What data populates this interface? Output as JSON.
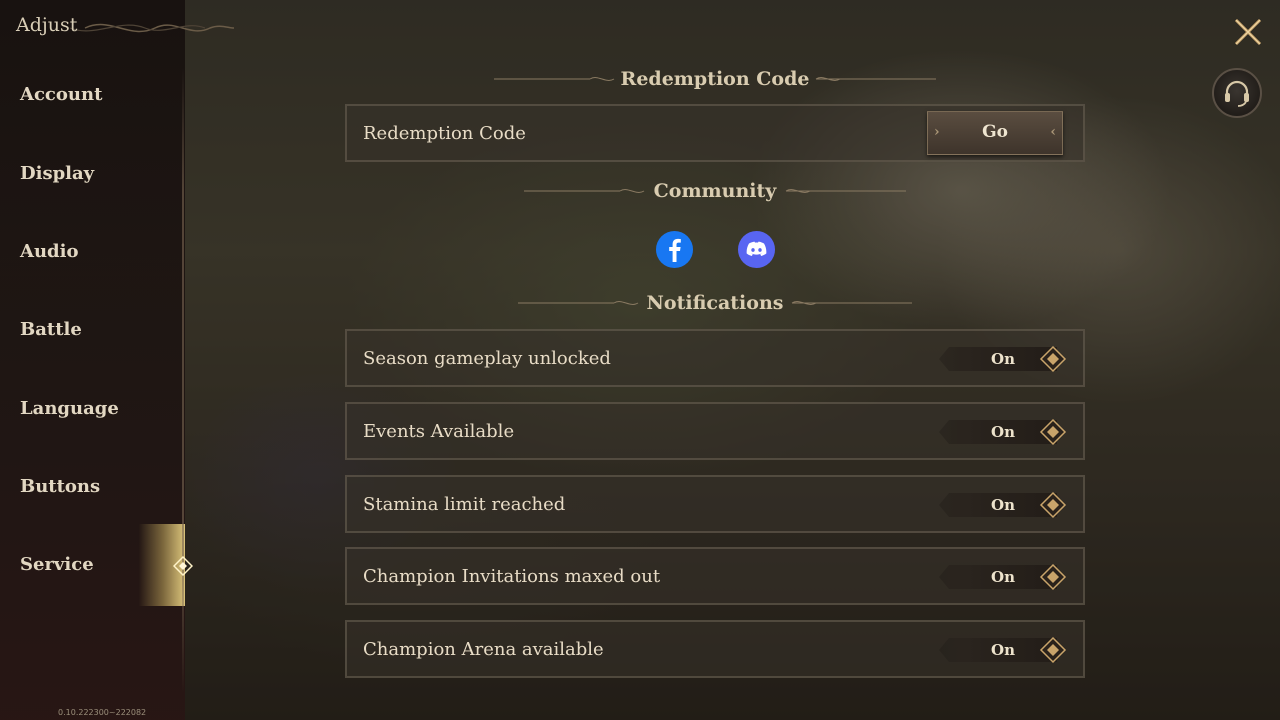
{
  "window": {
    "title": "Adjust",
    "version": "0.10.222300~222082"
  },
  "sidebar": {
    "items": [
      {
        "label": "Account"
      },
      {
        "label": "Display"
      },
      {
        "label": "Audio"
      },
      {
        "label": "Battle"
      },
      {
        "label": "Language"
      },
      {
        "label": "Buttons"
      },
      {
        "label": "Service",
        "active": true
      }
    ]
  },
  "sections": {
    "redemption": {
      "header": "Redemption Code",
      "row_label": "Redemption Code",
      "button_label": "Go"
    },
    "community": {
      "header": "Community",
      "links": [
        {
          "icon": "facebook-icon",
          "color": "#1877f2"
        },
        {
          "icon": "discord-icon",
          "color": "#5865f2"
        }
      ]
    },
    "notifications": {
      "header": "Notifications",
      "items": [
        {
          "label": "Season gameplay unlocked",
          "state": "On"
        },
        {
          "label": "Events Available",
          "state": "On"
        },
        {
          "label": "Stamina limit reached",
          "state": "On"
        },
        {
          "label": "Champion Invitations maxed out",
          "state": "On"
        },
        {
          "label": "Champion Arena available",
          "state": "On"
        }
      ]
    }
  },
  "colors": {
    "accent_gold": "#c9a46a",
    "text": "#e6dcc8",
    "panel_border": "#6e6455"
  }
}
